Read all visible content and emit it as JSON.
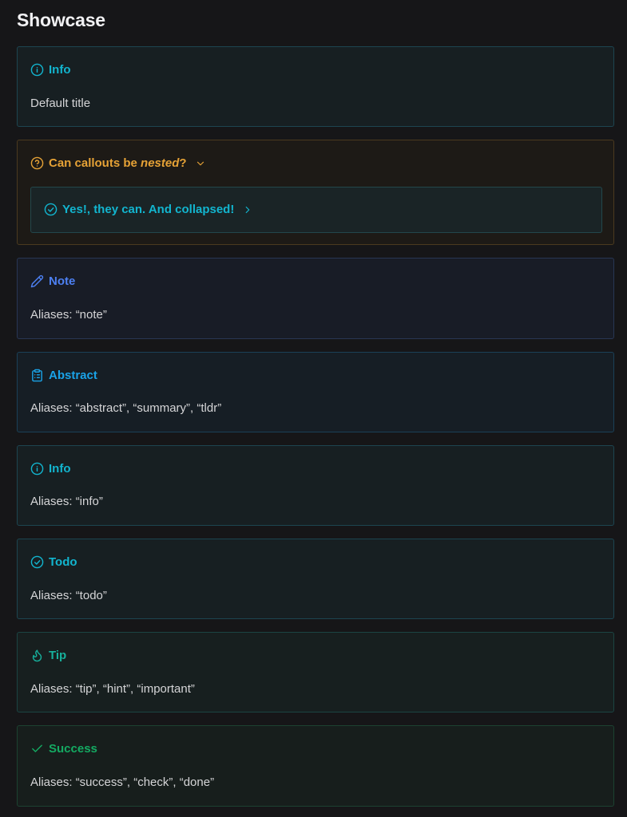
{
  "page": {
    "title": "Showcase"
  },
  "callouts": {
    "info_default": {
      "title": "Info",
      "body": "Default title",
      "icon": "info-circle-icon"
    },
    "question": {
      "title_prefix": "Can callouts be ",
      "title_emphasis": "nested",
      "title_suffix": "?",
      "icon": "question-circle-icon",
      "expanded": true,
      "nested": {
        "title": "Yes!, they can. And collapsed!",
        "icon": "check-circle-icon",
        "expanded": false
      }
    },
    "note": {
      "title": "Note",
      "body": "Aliases: “note”",
      "icon": "pencil-icon"
    },
    "abstract": {
      "title": "Abstract",
      "body": "Aliases: “abstract”, “summary”, “tldr”",
      "icon": "clipboard-icon"
    },
    "info": {
      "title": "Info",
      "body": "Aliases: “info”",
      "icon": "info-circle-icon"
    },
    "todo": {
      "title": "Todo",
      "body": "Aliases: “todo”",
      "icon": "check-circle-icon"
    },
    "tip": {
      "title": "Tip",
      "body": "Aliases: “tip”, “hint”, “important”",
      "icon": "flame-icon"
    },
    "success": {
      "title": "Success",
      "body": "Aliases: “success”, “check”, “done”",
      "icon": "check-icon"
    }
  },
  "colors": {
    "info": "#12b5cf",
    "question": "#e6a236",
    "note": "#4d80f3",
    "abstract": "#1aa3e8",
    "tip": "#17b09c",
    "success": "#14aa62"
  }
}
